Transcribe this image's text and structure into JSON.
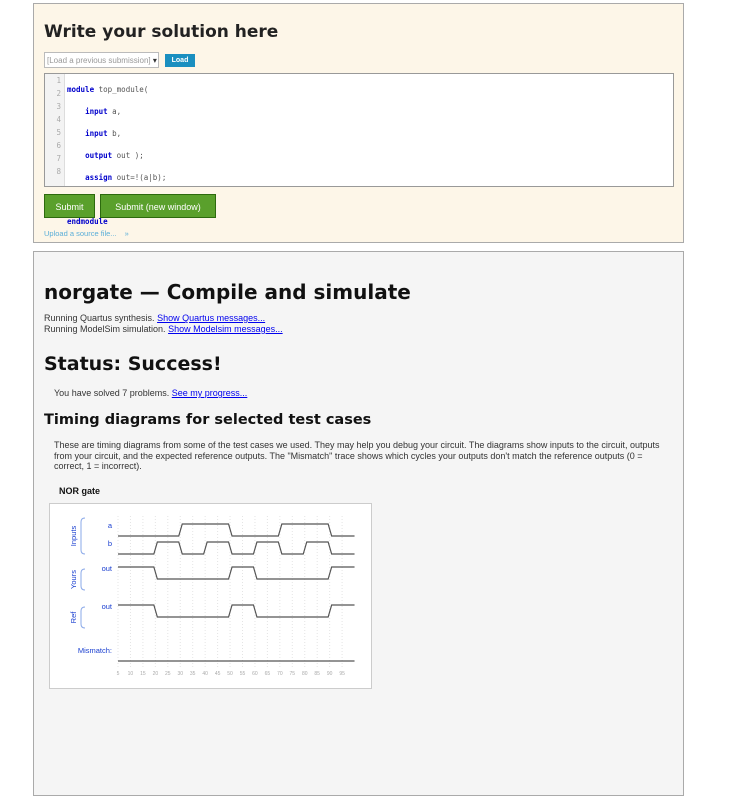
{
  "editor_panel": {
    "title": "Write your solution here",
    "select_placeholder": "[Load a previous submission]",
    "load_label": "Load",
    "line_numbers": [
      "1",
      "2",
      "3",
      "4",
      "5",
      "6",
      "7",
      "8"
    ],
    "submit_label": "Submit",
    "submit_new_label": "Submit (new window)",
    "upload_label": "Upload a source file...",
    "upload_icon": "double-chevron-down-icon"
  },
  "result_panel": {
    "title": "norgate — Compile and simulate",
    "quartus_text": "Running Quartus synthesis.",
    "quartus_link": "Show Quartus messages...",
    "modelsim_text": "Running ModelSim simulation.",
    "modelsim_link": "Show Modelsim messages...",
    "status": "Status: Success!",
    "solved_text": "You have solved 7 problems.",
    "progress_link": "See my progress...",
    "timing_title": "Timing diagrams for selected test cases",
    "timing_desc": "These are timing diagrams from some of the test cases we used. They may help you debug your circuit. The diagrams show inputs to the circuit, outputs from your circuit, and the expected reference outputs. The \"Mismatch\" trace shows which cycles your outputs don't match the reference outputs (0 = correct, 1 = incorrect).",
    "chart_title": "NOR gate"
  },
  "chart_data": {
    "type": "timing",
    "title": "NOR gate",
    "groups": [
      "Inputs",
      "Yours",
      "Ref"
    ],
    "x_ticks": [
      5,
      10,
      15,
      20,
      25,
      30,
      35,
      40,
      45,
      50,
      55,
      60,
      65,
      70,
      75,
      80,
      85,
      90,
      95
    ],
    "xlim": [
      5,
      100
    ],
    "signals": [
      {
        "group": "Inputs",
        "name": "a",
        "edges": [
          [
            5,
            0
          ],
          [
            30,
            1
          ],
          [
            50,
            0
          ],
          [
            70,
            1
          ],
          [
            90,
            0
          ]
        ]
      },
      {
        "group": "Inputs",
        "name": "b",
        "edges": [
          [
            5,
            0
          ],
          [
            20,
            1
          ],
          [
            30,
            0
          ],
          [
            40,
            1
          ],
          [
            50,
            0
          ],
          [
            60,
            1
          ],
          [
            70,
            0
          ],
          [
            80,
            1
          ],
          [
            90,
            0
          ]
        ]
      },
      {
        "group": "Yours",
        "name": "out",
        "edges": [
          [
            5,
            1
          ],
          [
            20,
            0
          ],
          [
            50,
            1
          ],
          [
            60,
            0
          ],
          [
            90,
            1
          ]
        ]
      },
      {
        "group": "Ref",
        "name": "out",
        "edges": [
          [
            5,
            1
          ],
          [
            20,
            0
          ],
          [
            50,
            1
          ],
          [
            60,
            0
          ],
          [
            90,
            1
          ]
        ]
      },
      {
        "group": "",
        "name": "Mismatch:",
        "edges": [
          [
            5,
            0
          ]
        ]
      }
    ]
  }
}
